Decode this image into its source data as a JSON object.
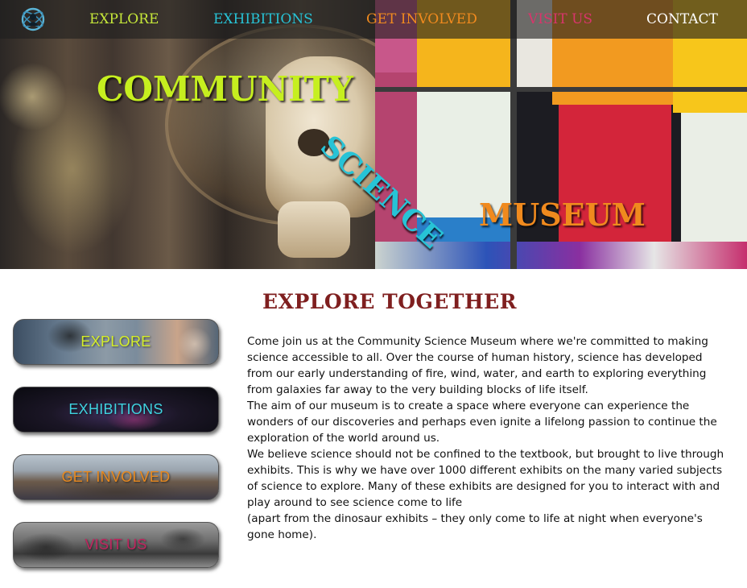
{
  "nav": {
    "items": [
      {
        "label": "EXPLORE",
        "color": "#c6e83a"
      },
      {
        "label": "EXHIBITIONS",
        "color": "#27c3d6"
      },
      {
        "label": "GET INVOLVED",
        "color": "#f08a1e"
      },
      {
        "label": "VISIT US",
        "color": "#d8356b"
      },
      {
        "label": "CONTACT",
        "color": "#ffffff"
      }
    ],
    "logo_icon": "atom-logo-icon"
  },
  "hero": {
    "title_1": "COMMUNITY",
    "title_2": "SCIENCE",
    "title_3": "MUSEUM",
    "colors": {
      "title_1": "#c6ef1f",
      "title_2": "#27c3d6",
      "title_3": "#f08a1e"
    }
  },
  "main": {
    "heading": "EXPLORE TOGETHER",
    "paragraphs": [
      "Come join us at the Community Science Museum where we're committed to making science accessible to all. Over the course of human history, science has developed from our early understanding of fire, wind, water, and earth to exploring everything from galaxies far away to the very building blocks of life itself.",
      "The aim of our museum is to create a space where everyone can experience the wonders of our discoveries and perhaps even ignite a lifelong passion to continue the exploration of the world around us.",
      "We believe science should not be confined to the textbook, but brought to live through exhibits. This is why we have over 1000 different exhibits on the many varied subjects of science to explore. Many of these exhibits are designed for you to interact with and play around to see science come to life",
      "(apart from the dinosaur exhibits – they only come to life at night when everyone's gone home)."
    ]
  },
  "side_buttons": [
    {
      "label": "EXPLORE",
      "color": "#d6ef2a"
    },
    {
      "label": "EXHIBITIONS",
      "color": "#3fd3e0"
    },
    {
      "label": "GET INVOLVED",
      "color": "#e8891f"
    },
    {
      "label": "VISIT US",
      "color": "#c2245f"
    }
  ]
}
